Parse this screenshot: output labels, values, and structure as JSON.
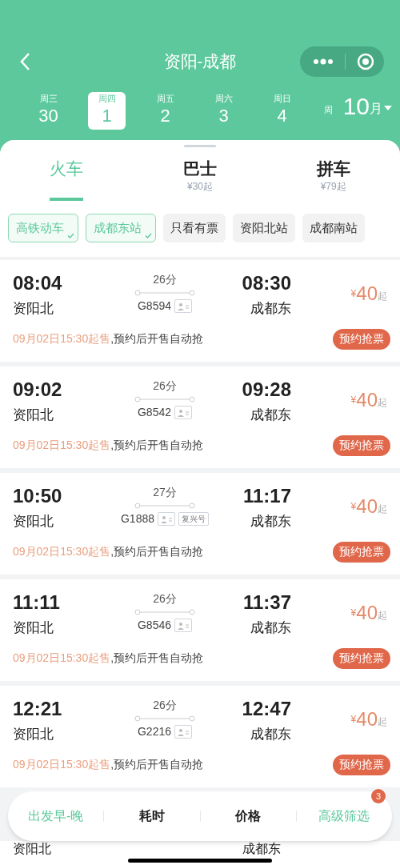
{
  "header": {
    "title": "资阳-成都"
  },
  "dates": [
    {
      "weekday": "周三",
      "day": "30",
      "selected": false
    },
    {
      "weekday": "周四",
      "day": "1",
      "selected": true
    },
    {
      "weekday": "周五",
      "day": "2",
      "selected": false
    },
    {
      "weekday": "周六",
      "day": "3",
      "selected": false
    },
    {
      "weekday": "周日",
      "day": "4",
      "selected": false
    },
    {
      "weekday": "周",
      "selected": false
    }
  ],
  "month": {
    "number": "10",
    "unit": "月"
  },
  "tabs": [
    {
      "label": "火车",
      "selected": true
    },
    {
      "label": "巴士",
      "sub": "¥30起",
      "selected": false
    },
    {
      "label": "拼车",
      "sub": "¥79起",
      "selected": false
    }
  ],
  "filters": [
    {
      "label": "高铁动车",
      "selected": true
    },
    {
      "label": "成都东站",
      "selected": true
    },
    {
      "label": "只看有票",
      "selected": false
    },
    {
      "label": "资阳北站",
      "selected": false
    },
    {
      "label": "成都南站",
      "selected": false
    }
  ],
  "trains": [
    {
      "depart": "08:04",
      "from": "资阳北",
      "duration": "26分",
      "number": "G8594",
      "arrive": "08:30",
      "to": "成都东",
      "currency": "¥",
      "price": "40",
      "price_suffix": "起",
      "sale_time": "09月02日15:30起售",
      "note": ",预约后开售自动抢",
      "action": "预约抢票"
    },
    {
      "depart": "09:02",
      "from": "资阳北",
      "duration": "26分",
      "number": "G8542",
      "arrive": "09:28",
      "to": "成都东",
      "currency": "¥",
      "price": "40",
      "price_suffix": "起",
      "sale_time": "09月02日15:30起售",
      "note": ",预约后开售自动抢",
      "action": "预约抢票"
    },
    {
      "depart": "10:50",
      "from": "资阳北",
      "duration": "27分",
      "number": "G1888",
      "badge": "复兴号",
      "arrive": "11:17",
      "to": "成都东",
      "currency": "¥",
      "price": "40",
      "price_suffix": "起",
      "sale_time": "09月02日15:30起售",
      "note": ",预约后开售自动抢",
      "action": "预约抢票"
    },
    {
      "depart": "11:11",
      "from": "资阳北",
      "duration": "26分",
      "number": "G8546",
      "arrive": "11:37",
      "to": "成都东",
      "currency": "¥",
      "price": "40",
      "price_suffix": "起",
      "sale_time": "09月02日15:30起售",
      "note": ",预约后开售自动抢",
      "action": "预约抢票"
    },
    {
      "depart": "12:21",
      "from": "资阳北",
      "duration": "26分",
      "number": "G2216",
      "arrive": "12:47",
      "to": "成都东",
      "currency": "¥",
      "price": "40",
      "price_suffix": "起",
      "sale_time": "09月02日15:30起售",
      "note": ",预约后开售自动抢",
      "action": "预约抢票"
    }
  ],
  "partial_train": {
    "from": "资阳北",
    "to": "成都东"
  },
  "sort_bar": [
    {
      "label": "出发早-晚",
      "active": true
    },
    {
      "label": "耗时",
      "active": false
    },
    {
      "label": "价格",
      "active": false
    },
    {
      "label": "高级筛选",
      "active": true,
      "badge": "3"
    }
  ]
}
